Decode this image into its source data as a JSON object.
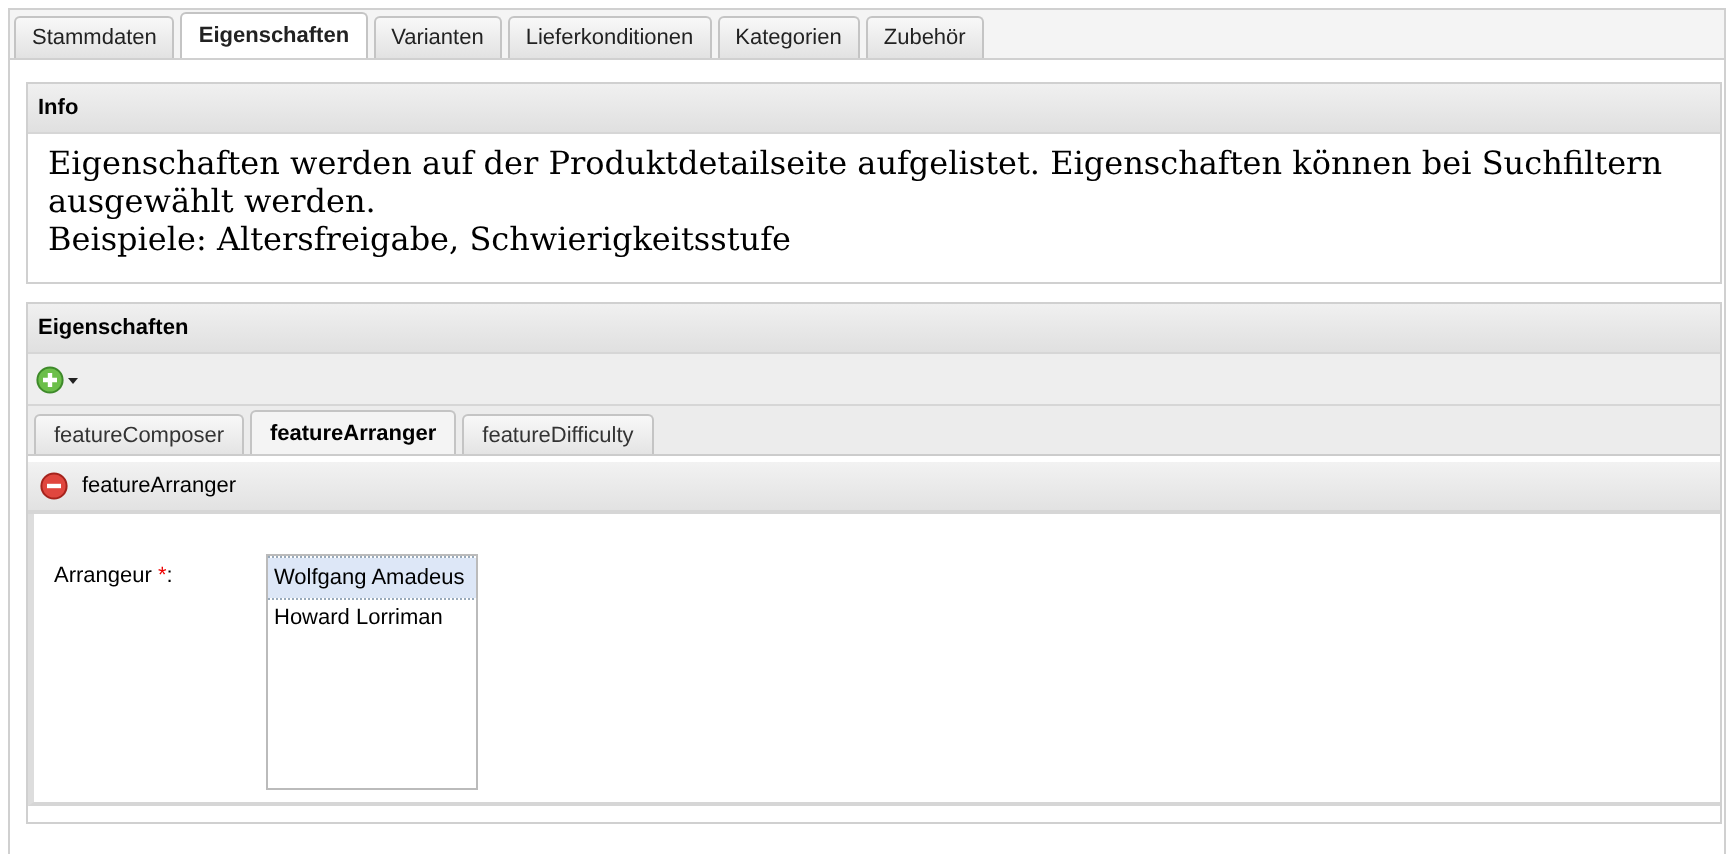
{
  "tabs": [
    {
      "label": "Stammdaten",
      "selected": false
    },
    {
      "label": "Eigenschaften",
      "selected": true
    },
    {
      "label": "Varianten",
      "selected": false
    },
    {
      "label": "Lieferkonditionen",
      "selected": false
    },
    {
      "label": "Kategorien",
      "selected": false
    },
    {
      "label": "Zubehör",
      "selected": false
    }
  ],
  "info": {
    "title": "Info",
    "lines": [
      "Eigenschaften werden auf der Produktdetailseite aufgelistet. Eigenschaften können bei Suchfiltern ausgewählt werden.",
      "Beispiele: Altersfreigabe, Schwierigkeitsstufe"
    ]
  },
  "properties": {
    "title": "Eigenschaften",
    "tabs": [
      {
        "label": "featureComposer",
        "selected": false
      },
      {
        "label": "featureArranger",
        "selected": true
      },
      {
        "label": "featureDifficulty",
        "selected": false
      }
    ],
    "feature": {
      "title": "featureArranger",
      "field": {
        "label": "Arrangeur ",
        "required_mark": "*",
        "suffix": ":",
        "options": [
          {
            "label": "Wolfgang Amadeus",
            "selected": true
          },
          {
            "label": "Howard Lorriman",
            "selected": false
          }
        ]
      }
    }
  }
}
